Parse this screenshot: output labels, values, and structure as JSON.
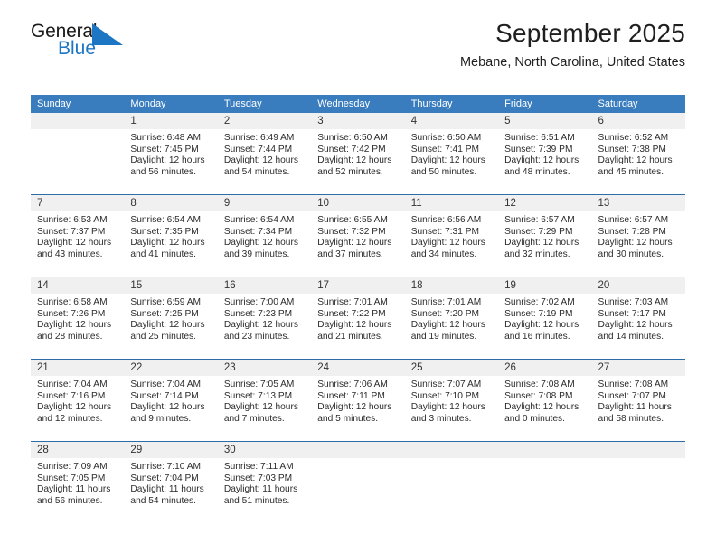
{
  "brand": {
    "name_top": "General",
    "name_bottom": "Blue",
    "accent_color": "#1d76c4"
  },
  "header": {
    "title": "September 2025",
    "subtitle": "Mebane, North Carolina, United States"
  },
  "calendar": {
    "header_color": "#3a7dbf",
    "weekdays": [
      "Sunday",
      "Monday",
      "Tuesday",
      "Wednesday",
      "Thursday",
      "Friday",
      "Saturday"
    ],
    "weeks": [
      [
        {
          "day": "",
          "sunrise": "",
          "sunset": "",
          "daylight1": "",
          "daylight2": ""
        },
        {
          "day": "1",
          "sunrise": "Sunrise: 6:48 AM",
          "sunset": "Sunset: 7:45 PM",
          "daylight1": "Daylight: 12 hours",
          "daylight2": "and 56 minutes."
        },
        {
          "day": "2",
          "sunrise": "Sunrise: 6:49 AM",
          "sunset": "Sunset: 7:44 PM",
          "daylight1": "Daylight: 12 hours",
          "daylight2": "and 54 minutes."
        },
        {
          "day": "3",
          "sunrise": "Sunrise: 6:50 AM",
          "sunset": "Sunset: 7:42 PM",
          "daylight1": "Daylight: 12 hours",
          "daylight2": "and 52 minutes."
        },
        {
          "day": "4",
          "sunrise": "Sunrise: 6:50 AM",
          "sunset": "Sunset: 7:41 PM",
          "daylight1": "Daylight: 12 hours",
          "daylight2": "and 50 minutes."
        },
        {
          "day": "5",
          "sunrise": "Sunrise: 6:51 AM",
          "sunset": "Sunset: 7:39 PM",
          "daylight1": "Daylight: 12 hours",
          "daylight2": "and 48 minutes."
        },
        {
          "day": "6",
          "sunrise": "Sunrise: 6:52 AM",
          "sunset": "Sunset: 7:38 PM",
          "daylight1": "Daylight: 12 hours",
          "daylight2": "and 45 minutes."
        }
      ],
      [
        {
          "day": "7",
          "sunrise": "Sunrise: 6:53 AM",
          "sunset": "Sunset: 7:37 PM",
          "daylight1": "Daylight: 12 hours",
          "daylight2": "and 43 minutes."
        },
        {
          "day": "8",
          "sunrise": "Sunrise: 6:54 AM",
          "sunset": "Sunset: 7:35 PM",
          "daylight1": "Daylight: 12 hours",
          "daylight2": "and 41 minutes."
        },
        {
          "day": "9",
          "sunrise": "Sunrise: 6:54 AM",
          "sunset": "Sunset: 7:34 PM",
          "daylight1": "Daylight: 12 hours",
          "daylight2": "and 39 minutes."
        },
        {
          "day": "10",
          "sunrise": "Sunrise: 6:55 AM",
          "sunset": "Sunset: 7:32 PM",
          "daylight1": "Daylight: 12 hours",
          "daylight2": "and 37 minutes."
        },
        {
          "day": "11",
          "sunrise": "Sunrise: 6:56 AM",
          "sunset": "Sunset: 7:31 PM",
          "daylight1": "Daylight: 12 hours",
          "daylight2": "and 34 minutes."
        },
        {
          "day": "12",
          "sunrise": "Sunrise: 6:57 AM",
          "sunset": "Sunset: 7:29 PM",
          "daylight1": "Daylight: 12 hours",
          "daylight2": "and 32 minutes."
        },
        {
          "day": "13",
          "sunrise": "Sunrise: 6:57 AM",
          "sunset": "Sunset: 7:28 PM",
          "daylight1": "Daylight: 12 hours",
          "daylight2": "and 30 minutes."
        }
      ],
      [
        {
          "day": "14",
          "sunrise": "Sunrise: 6:58 AM",
          "sunset": "Sunset: 7:26 PM",
          "daylight1": "Daylight: 12 hours",
          "daylight2": "and 28 minutes."
        },
        {
          "day": "15",
          "sunrise": "Sunrise: 6:59 AM",
          "sunset": "Sunset: 7:25 PM",
          "daylight1": "Daylight: 12 hours",
          "daylight2": "and 25 minutes."
        },
        {
          "day": "16",
          "sunrise": "Sunrise: 7:00 AM",
          "sunset": "Sunset: 7:23 PM",
          "daylight1": "Daylight: 12 hours",
          "daylight2": "and 23 minutes."
        },
        {
          "day": "17",
          "sunrise": "Sunrise: 7:01 AM",
          "sunset": "Sunset: 7:22 PM",
          "daylight1": "Daylight: 12 hours",
          "daylight2": "and 21 minutes."
        },
        {
          "day": "18",
          "sunrise": "Sunrise: 7:01 AM",
          "sunset": "Sunset: 7:20 PM",
          "daylight1": "Daylight: 12 hours",
          "daylight2": "and 19 minutes."
        },
        {
          "day": "19",
          "sunrise": "Sunrise: 7:02 AM",
          "sunset": "Sunset: 7:19 PM",
          "daylight1": "Daylight: 12 hours",
          "daylight2": "and 16 minutes."
        },
        {
          "day": "20",
          "sunrise": "Sunrise: 7:03 AM",
          "sunset": "Sunset: 7:17 PM",
          "daylight1": "Daylight: 12 hours",
          "daylight2": "and 14 minutes."
        }
      ],
      [
        {
          "day": "21",
          "sunrise": "Sunrise: 7:04 AM",
          "sunset": "Sunset: 7:16 PM",
          "daylight1": "Daylight: 12 hours",
          "daylight2": "and 12 minutes."
        },
        {
          "day": "22",
          "sunrise": "Sunrise: 7:04 AM",
          "sunset": "Sunset: 7:14 PM",
          "daylight1": "Daylight: 12 hours",
          "daylight2": "and 9 minutes."
        },
        {
          "day": "23",
          "sunrise": "Sunrise: 7:05 AM",
          "sunset": "Sunset: 7:13 PM",
          "daylight1": "Daylight: 12 hours",
          "daylight2": "and 7 minutes."
        },
        {
          "day": "24",
          "sunrise": "Sunrise: 7:06 AM",
          "sunset": "Sunset: 7:11 PM",
          "daylight1": "Daylight: 12 hours",
          "daylight2": "and 5 minutes."
        },
        {
          "day": "25",
          "sunrise": "Sunrise: 7:07 AM",
          "sunset": "Sunset: 7:10 PM",
          "daylight1": "Daylight: 12 hours",
          "daylight2": "and 3 minutes."
        },
        {
          "day": "26",
          "sunrise": "Sunrise: 7:08 AM",
          "sunset": "Sunset: 7:08 PM",
          "daylight1": "Daylight: 12 hours",
          "daylight2": "and 0 minutes."
        },
        {
          "day": "27",
          "sunrise": "Sunrise: 7:08 AM",
          "sunset": "Sunset: 7:07 PM",
          "daylight1": "Daylight: 11 hours",
          "daylight2": "and 58 minutes."
        }
      ],
      [
        {
          "day": "28",
          "sunrise": "Sunrise: 7:09 AM",
          "sunset": "Sunset: 7:05 PM",
          "daylight1": "Daylight: 11 hours",
          "daylight2": "and 56 minutes."
        },
        {
          "day": "29",
          "sunrise": "Sunrise: 7:10 AM",
          "sunset": "Sunset: 7:04 PM",
          "daylight1": "Daylight: 11 hours",
          "daylight2": "and 54 minutes."
        },
        {
          "day": "30",
          "sunrise": "Sunrise: 7:11 AM",
          "sunset": "Sunset: 7:03 PM",
          "daylight1": "Daylight: 11 hours",
          "daylight2": "and 51 minutes."
        },
        {
          "day": "",
          "sunrise": "",
          "sunset": "",
          "daylight1": "",
          "daylight2": ""
        },
        {
          "day": "",
          "sunrise": "",
          "sunset": "",
          "daylight1": "",
          "daylight2": ""
        },
        {
          "day": "",
          "sunrise": "",
          "sunset": "",
          "daylight1": "",
          "daylight2": ""
        },
        {
          "day": "",
          "sunrise": "",
          "sunset": "",
          "daylight1": "",
          "daylight2": ""
        }
      ]
    ]
  }
}
